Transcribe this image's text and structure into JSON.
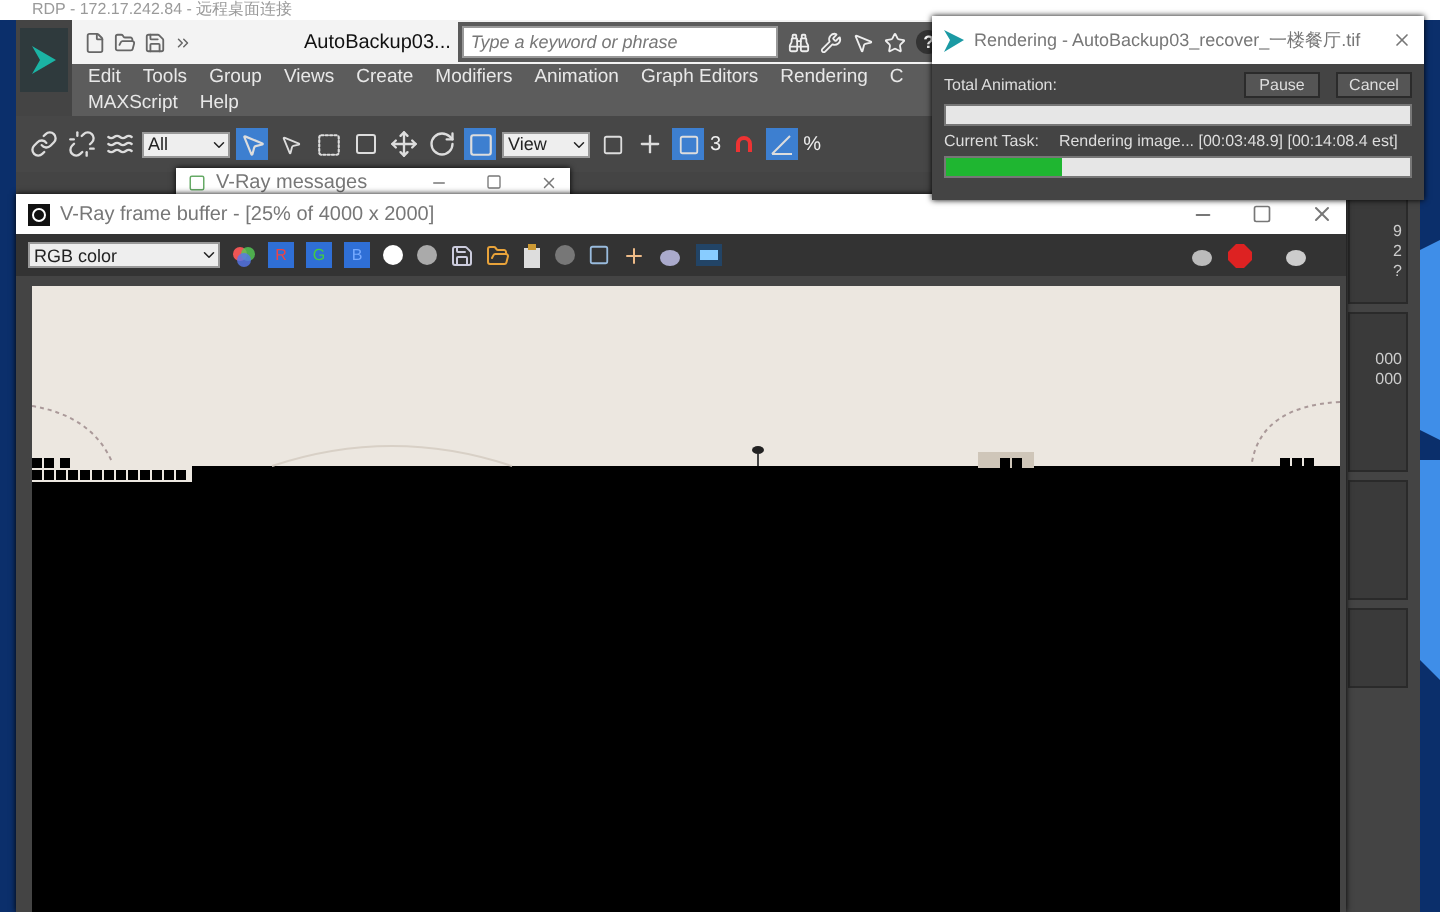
{
  "remote_session": {
    "title": "RDP - 172.17.242.84 - 远程桌面连接"
  },
  "max_window": {
    "file_title": "AutoBackup03...",
    "search": {
      "placeholder": "Type a keyword or phrase"
    },
    "help_label": "?",
    "menu_rows": [
      {
        "items": [
          "Edit",
          "Tools",
          "Group",
          "Views",
          "Create",
          "Modifiers",
          "Animation",
          "Graph Editors",
          "Rendering",
          "C"
        ]
      },
      {
        "items": [
          "MAXScript",
          "Help"
        ]
      }
    ],
    "selection_filter": "All",
    "reference_coord": "View",
    "angle_snap_label": "3",
    "percent_snap_label": "%",
    "side_panel": [
      "9",
      "2",
      "?",
      "000",
      "000"
    ]
  },
  "vray_messages": {
    "title": "V-Ray messages"
  },
  "frame_buffer": {
    "title": "V-Ray frame buffer - [25% of 4000 x 2000]",
    "channel_select": "RGB color",
    "channels": [
      {
        "label": "R",
        "on": true
      },
      {
        "label": "G",
        "on": true
      },
      {
        "label": "B",
        "on": true
      }
    ]
  },
  "render_dialog": {
    "title": "Rendering - AutoBackup03_recover_一楼餐厅.tif",
    "buttons": [
      "Pause",
      "Cancel"
    ],
    "total_label": "Total Animation:",
    "total": {
      "level": 0
    },
    "task_label": "Current Task:",
    "task_status": "Rendering image... [00:03:48.9] [00:14:08.4 est]",
    "task": {
      "level": 0.25
    }
  }
}
